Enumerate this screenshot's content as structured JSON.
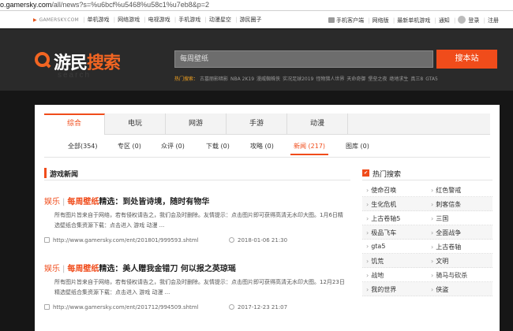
{
  "browser": {
    "url_prefix": "",
    "url_domain": "o.gamersky.com",
    "url_rest": "/all/news?s=%u6bcf%u5468%u58c1%u7eb8&p=2"
  },
  "topnav": {
    "domain": "GAMERSKY.COM",
    "left": [
      "单机游戏",
      "网络游戏",
      "电视游戏",
      "手机游戏",
      "动漫星空",
      "游民圈子"
    ],
    "right": [
      "手机客户端",
      "网络版",
      "最新单机游戏",
      "通知",
      "登录",
      "注册"
    ]
  },
  "header": {
    "logo_white": "游民",
    "logo_orange": "搜索",
    "logo_sub": "search",
    "search_placeholder": "每周壁纸",
    "search_button": "搜本站",
    "hot_label": "热门搜索：",
    "hot_items": [
      "古墓丽影暗影",
      "NBA 2K19",
      "漫威蜘蛛侠",
      "实况足球2019",
      "怪物猎人世界",
      "天命奇御",
      "堡垒之夜",
      "绝地求生",
      "真三8",
      "GTA5"
    ]
  },
  "tabs": [
    "综合",
    "电玩",
    "网游",
    "手游",
    "动漫"
  ],
  "active_tab": "综合",
  "subtabs": [
    "全部(354)",
    "专区 (0)",
    "众评 (0)",
    "下载 (0)",
    "攻略 (0)",
    "新闻 (217)",
    "图库 (0)"
  ],
  "active_subtab": "新闻 (217)",
  "section_title": "游戏新闻",
  "news": [
    {
      "category": "娱乐",
      "highlight": "每周壁纸",
      "title_rest": "精选：到处皆诗境，随时有物华",
      "desc": "所有图片皆来自于网络，若有侵权请告之，我们会及时删除。友情提示：点击图片即可获得高清无水印大图。1月6日精选壁纸合集资源下载：点击进入 游戏 动漫 ...",
      "url": "http://www.gamersky.com/ent/201801/999593.shtml",
      "date": "2018-01-06 21:30"
    },
    {
      "category": "娱乐",
      "highlight": "每周壁纸",
      "title_rest": "精选：美人赠我金错刀 何以报之英琼瑶",
      "desc": "所有图片皆来自于网络，若有侵权请告之，我们会及时删除。友情提示：点击图片即可获得高清无水印大图。12月23日精选壁纸合集资源下载：点击进入 游戏 动漫 ...",
      "url": "http://www.gamersky.com/ent/201712/994509.shtml",
      "date": "2017-12-23 21:07"
    }
  ],
  "sidebar": {
    "title": "热门搜索",
    "items": [
      "使命召唤",
      "红色警戒",
      "生化危机",
      "刺客信条",
      "上古卷轴5",
      "三国",
      "极品飞车",
      "全面战争",
      "gta5",
      "上古卷轴",
      "饥荒",
      "文明",
      "战地",
      "骑马与砍杀",
      "我的世界",
      "侠盗"
    ]
  }
}
